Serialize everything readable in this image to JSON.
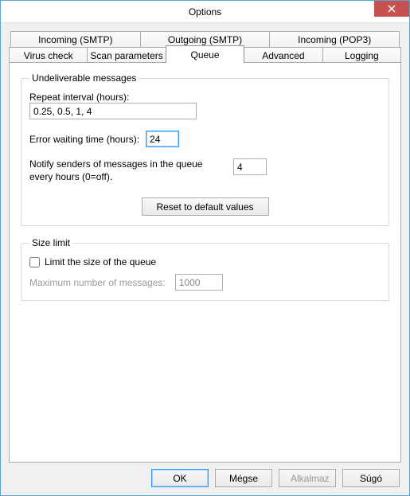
{
  "window": {
    "title": "Options"
  },
  "tabs": {
    "row1": [
      "Incoming (SMTP)",
      "Outgoing (SMTP)",
      "Incoming (POP3)"
    ],
    "row2": [
      "Virus check",
      "Scan parameters",
      "Queue",
      "Advanced",
      "Logging"
    ],
    "active": "Queue"
  },
  "undeliverable": {
    "legend": "Undeliverable messages",
    "repeat_label": "Repeat interval (hours):",
    "repeat_value": "0.25, 0.5, 1, 4",
    "error_wait_label": "Error waiting time (hours):",
    "error_wait_value": "24",
    "notify_label": "Notify senders of messages in the queue every hours (0=off).",
    "notify_value": "4",
    "reset_label": "Reset to default values"
  },
  "sizelimit": {
    "legend": "Size limit",
    "checkbox_label": "Limit the size of the queue",
    "checkbox_checked": false,
    "max_label": "Maximum number of messages:",
    "max_value": "1000"
  },
  "buttons": {
    "ok": "OK",
    "cancel": "Mégse",
    "apply": "Alkalmaz",
    "help": "Súgó"
  }
}
